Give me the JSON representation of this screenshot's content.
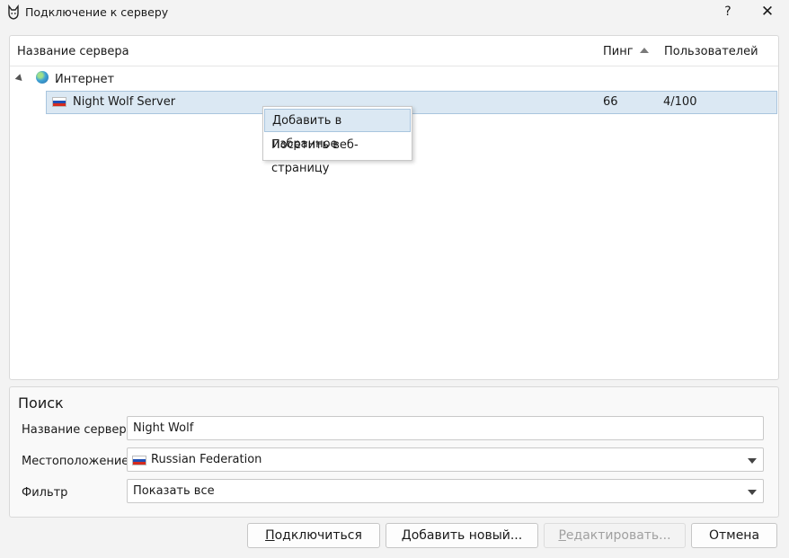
{
  "window": {
    "title": "Подключение к серверу",
    "help": "?",
    "close": "✕"
  },
  "columns": {
    "name": "Название сервера",
    "ping": "Пинг",
    "users": "Пользователей"
  },
  "tree": {
    "group_label": "Интернет",
    "server": {
      "name": "Night Wolf Server",
      "ping": "66",
      "users": "4/100"
    }
  },
  "context_menu": {
    "items": [
      "Добавить в избранное",
      "Посетить веб-страницу"
    ]
  },
  "search": {
    "title": "Поиск",
    "name_label": "Название сервера",
    "name_value": "Night Wolf",
    "location_label": "Местоположение",
    "location_value": "Russian Federation",
    "filter_label": "Фильтр",
    "filter_value": "Показать все"
  },
  "buttons": {
    "connect_first": "П",
    "connect_rest": "одключиться",
    "add_pre": "Д",
    "add_rest": "обавить новый...",
    "edit_first": "Р",
    "edit_rest": "едактировать...",
    "cancel": "Отмена"
  },
  "colors": {
    "selection": "#dbe8f3",
    "selection_border": "#a9c5de"
  }
}
